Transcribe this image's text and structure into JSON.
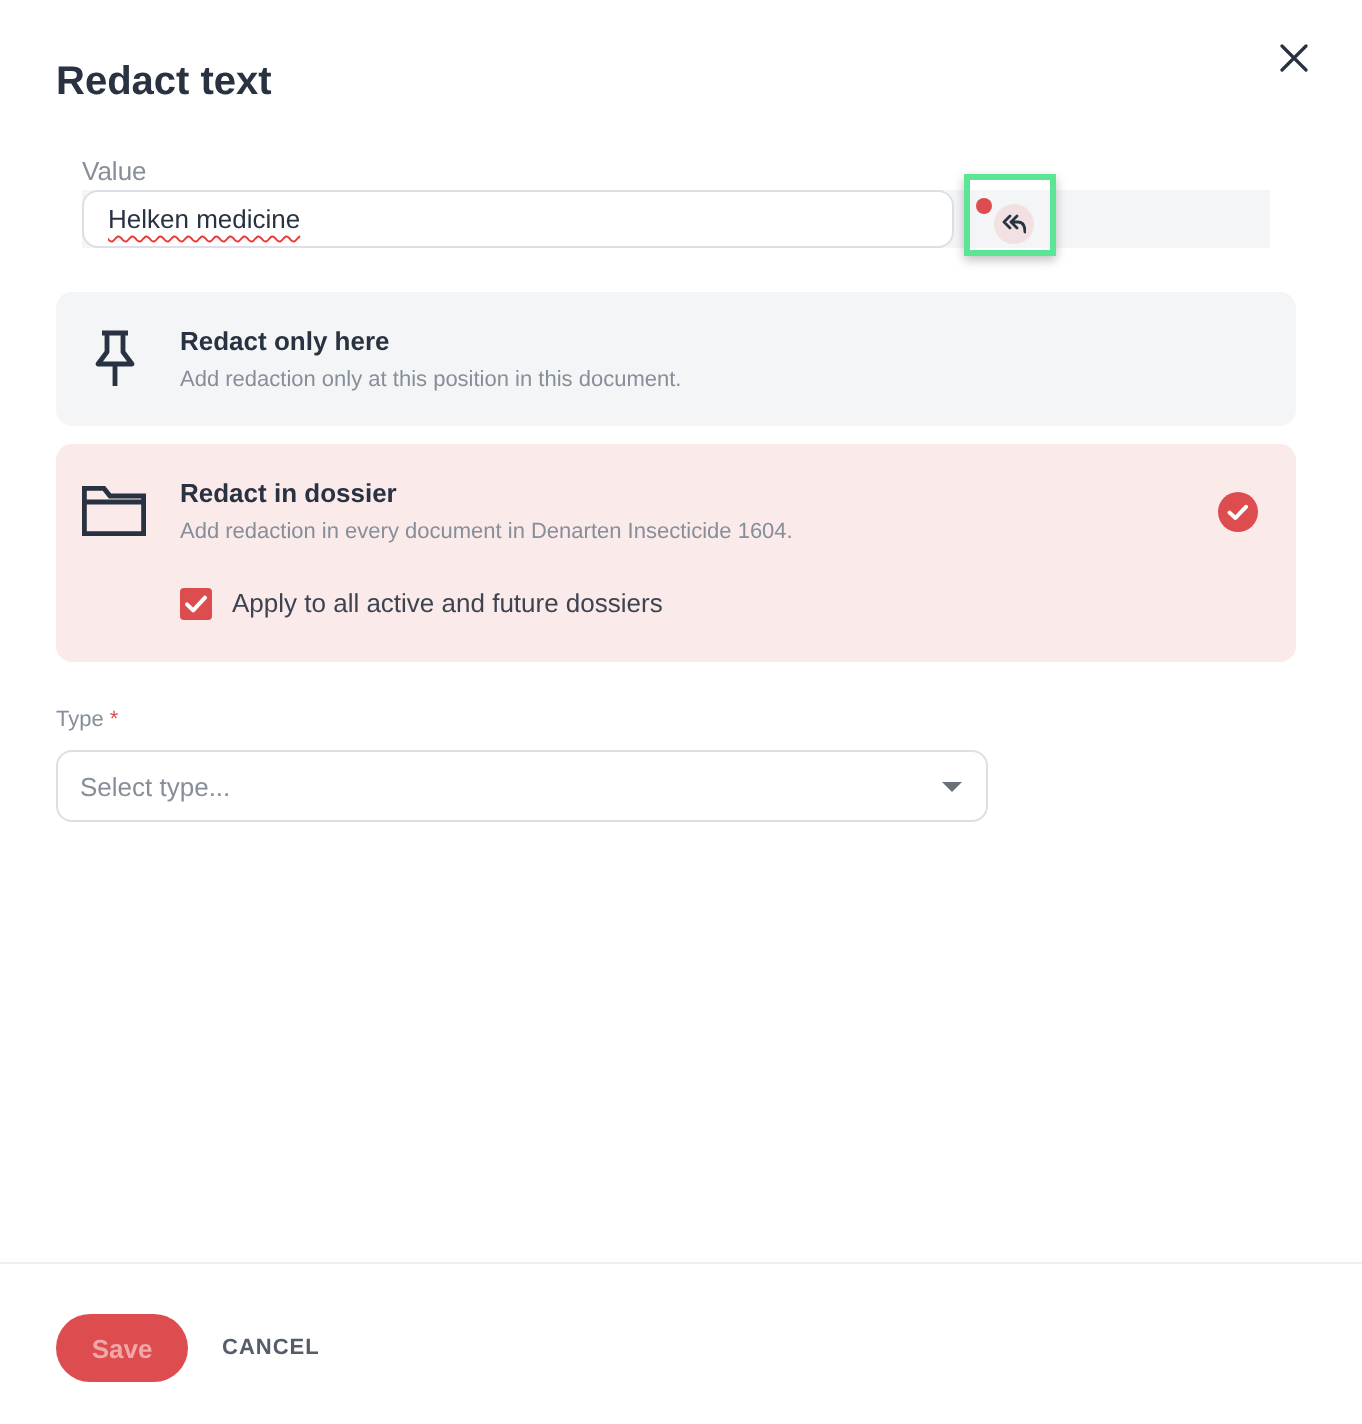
{
  "dialog": {
    "title": "Redact text"
  },
  "value_field": {
    "label": "Value",
    "value": "Helken medicine",
    "misspelled": true,
    "modified": true,
    "highlighted": true
  },
  "options": [
    {
      "title": "Redact only here",
      "description": "Add redaction only at this position in this document.",
      "selected": false
    },
    {
      "title": "Redact in dossier",
      "description": "Add redaction in every document in Denarten Insecticide 1604.",
      "selected": true,
      "checkbox": {
        "label": "Apply to all active and future dossiers",
        "checked": true
      }
    }
  ],
  "type_field": {
    "label": "Type",
    "required_mark": "*",
    "placeholder": "Select type..."
  },
  "buttons": [
    {
      "label": "Save",
      "kind": "primary",
      "disabled": true
    },
    {
      "label": "CANCEL",
      "kind": "text",
      "disabled": false
    }
  ]
}
